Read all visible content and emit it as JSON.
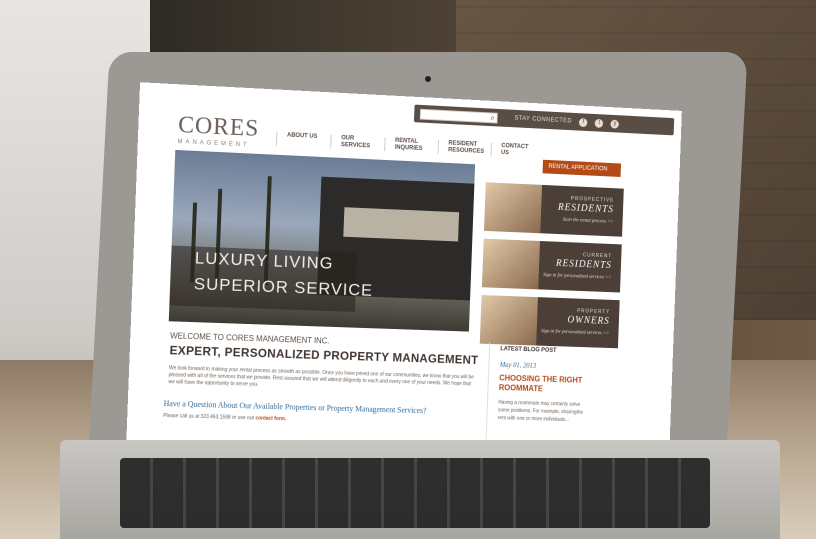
{
  "site": {
    "logo_main": "CORES",
    "logo_sub": "MANAGEMENT",
    "search_icon": "search-icon",
    "stay_connected": "STAY CONNECTED",
    "social": [
      "f",
      "t",
      "y"
    ],
    "nav": [
      "ABOUT US",
      "OUR SERVICES",
      "RENTAL INQURIES",
      "RESIDENT RESOURCES",
      "CONTACT US"
    ],
    "rental_button": "RENTAL APPLICATION",
    "hero_line1": "LUXURY LIVING",
    "hero_line2": "SUPERIOR SERVICE",
    "cards": [
      {
        "kicker": "PROSPECTIVE",
        "title": "RESIDENTS",
        "sub": "Start the rental process >>"
      },
      {
        "kicker": "CURRENT",
        "title": "RESIDENTS",
        "sub": "Sign in for personalized services >>"
      },
      {
        "kicker": "PROPERTY",
        "title": "OWNERS",
        "sub": "Sign in for personalized services >>"
      }
    ],
    "welcome": "WELCOME TO CORES MANAGEMENT INC.",
    "headline": "EXPERT, PERSONALIZED PROPERTY MANAGEMENT",
    "paragraph": "We look forward to making your rental process as smooth as possible. Once you have joined one of our communities, we know that you will be pleased with all of the services that we provide. Rest assured that we will attend diligently to each and every one of your needs. We hope that we will have the opportunity to serve you.",
    "question": "Have a Question About Our Available Properties or Property Management Services?",
    "call_prefix": "Please call us at 323.463.1598 or use our",
    "contact_link": "contact form.",
    "blog": {
      "label": "LATEST BLOG POST",
      "date": "May 01, 2013",
      "title": "CHOOSING THE RIGHT ROOMMATE",
      "text": "Having a roommate may certainly solve some problems. For example, sharingthe rent with one or more individuals..."
    }
  },
  "colors": {
    "brand": "#5a4d44",
    "accent": "#b34b18",
    "link": "#2e6b99"
  }
}
